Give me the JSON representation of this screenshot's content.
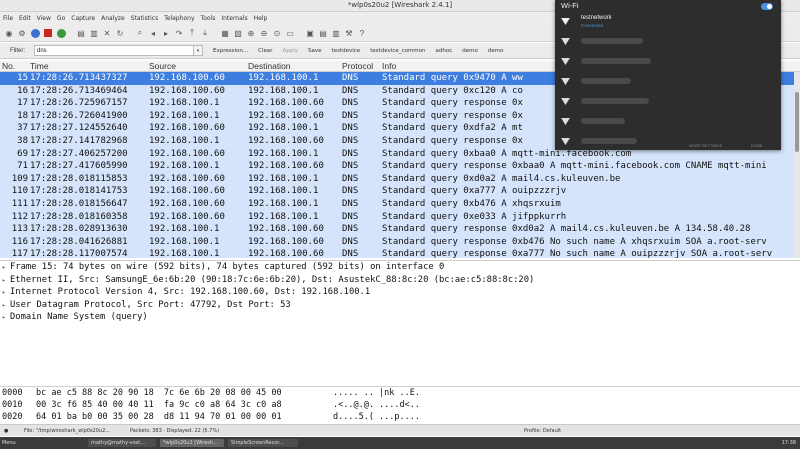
{
  "window": {
    "title": "*wlp0s20u2 [Wireshark 2.4.1]"
  },
  "menu": [
    "File",
    "Edit",
    "View",
    "Go",
    "Capture",
    "Analyze",
    "Statistics",
    "Telephony",
    "Tools",
    "Internals",
    "Help"
  ],
  "filter": {
    "label": "Filter:",
    "value": "dns",
    "buttons": [
      "Expression...",
      "Clear",
      "Apply",
      "Save",
      "testdevice",
      "testdevice_common",
      "adhoc",
      "demo",
      "demo"
    ]
  },
  "packet_list": {
    "columns": [
      "No.",
      "Time",
      "Source",
      "Destination",
      "Protocol",
      "Info"
    ],
    "selected_index": 0,
    "rows": [
      {
        "no": "15",
        "time": "17:28:26.713437327",
        "src": "192.168.100.60",
        "dst": "192.168.100.1",
        "proto": "DNS",
        "info": "Standard query 0x9470 A ww"
      },
      {
        "no": "16",
        "time": "17:28:26.713469464",
        "src": "192.168.100.60",
        "dst": "192.168.100.1",
        "proto": "DNS",
        "info": "Standard query 0xc120 A co"
      },
      {
        "no": "17",
        "time": "17:28:26.725967157",
        "src": "192.168.100.1",
        "dst": "192.168.100.60",
        "proto": "DNS",
        "info": "Standard query response 0x"
      },
      {
        "no": "18",
        "time": "17:28:26.726041900",
        "src": "192.168.100.1",
        "dst": "192.168.100.60",
        "proto": "DNS",
        "info": "Standard query response 0x"
      },
      {
        "no": "37",
        "time": "17:28:27.124552640",
        "src": "192.168.100.60",
        "dst": "192.168.100.1",
        "proto": "DNS",
        "info": "Standard query 0xdfa2 A mt"
      },
      {
        "no": "38",
        "time": "17:28:27.141782968",
        "src": "192.168.100.1",
        "dst": "192.168.100.60",
        "proto": "DNS",
        "info": "Standard query response 0x"
      },
      {
        "no": "69",
        "time": "17:28:27.406257200",
        "src": "192.168.100.60",
        "dst": "192.168.100.1",
        "proto": "DNS",
        "info": "Standard query 0xbaa0 A mqtt-mini.facebook.com"
      },
      {
        "no": "71",
        "time": "17:28:27.417605990",
        "src": "192.168.100.1",
        "dst": "192.168.100.60",
        "proto": "DNS",
        "info": "Standard query response 0xbaa0 A mqtt-mini.facebook.com CNAME mqtt-mini"
      },
      {
        "no": "109",
        "time": "17:28:28.018115853",
        "src": "192.168.100.60",
        "dst": "192.168.100.1",
        "proto": "DNS",
        "info": "Standard query 0xd0a2 A mail4.cs.kuleuven.be"
      },
      {
        "no": "110",
        "time": "17:28:28.018141753",
        "src": "192.168.100.60",
        "dst": "192.168.100.1",
        "proto": "DNS",
        "info": "Standard query 0xa777 A ouipzzzrjv"
      },
      {
        "no": "111",
        "time": "17:28:28.018156647",
        "src": "192.168.100.60",
        "dst": "192.168.100.1",
        "proto": "DNS",
        "info": "Standard query 0xb476 A xhqsrxuim"
      },
      {
        "no": "112",
        "time": "17:28:28.018160358",
        "src": "192.168.100.60",
        "dst": "192.168.100.1",
        "proto": "DNS",
        "info": "Standard query 0xe033 A jifppkurrh"
      },
      {
        "no": "113",
        "time": "17:28:28.028913630",
        "src": "192.168.100.1",
        "dst": "192.168.100.60",
        "proto": "DNS",
        "info": "Standard query response 0xd0a2 A mail4.cs.kuleuven.be A 134.58.40.28"
      },
      {
        "no": "116",
        "time": "17:28:28.041626881",
        "src": "192.168.100.1",
        "dst": "192.168.100.60",
        "proto": "DNS",
        "info": "Standard query response 0xb476 No such name A xhqsrxuim SOA a.root-serv"
      },
      {
        "no": "117",
        "time": "17:28:28.117007574",
        "src": "192.168.100.1",
        "dst": "192.168.100.60",
        "proto": "DNS",
        "info": "Standard query response 0xa777 No such name A ouipzzzrjv SOA a.root-serv"
      }
    ]
  },
  "details": [
    "Frame 15: 74 bytes on wire (592 bits), 74 bytes captured (592 bits) on interface 0",
    "Ethernet II, Src: SamsungE_6e:6b:20 (90:18:7c:6e:6b:20), Dst: AsustekC_88:8c:20 (bc:ae:c5:88:8c:20)",
    "Internet Protocol Version 4, Src: 192.168.100.60, Dst: 192.168.100.1",
    "User Datagram Protocol, Src Port: 47792, Dst Port: 53",
    "Domain Name System (query)"
  ],
  "hex": [
    {
      "offset": "0000",
      "bytes": "bc ae c5 88 8c 20 90 18  7c 6e 6b 20 08 00 45 00",
      "ascii": "..... .. |nk ..E."
    },
    {
      "offset": "0010",
      "bytes": "00 3c f6 85 40 00 40 11  fa 9c c0 a8 64 3c c0 a8",
      "ascii": ".<..@.@. ....d<.."
    },
    {
      "offset": "0020",
      "bytes": "64 01 ba b0 00 35 00 28  d8 11 94 70 01 00 00 01",
      "ascii": "d....5.( ...p...."
    }
  ],
  "status": {
    "file": "File: \"/tmp/wireshark_wlp0s20u2...",
    "packets": "Packets: 383 · Displayed: 22 (5.7%)",
    "profile": "Profile: Default"
  },
  "taskbar": {
    "menu": "Menu",
    "items": [
      "mathy@mathy-vost...",
      "*wlp0s20u2 [Wiresh...",
      "SimpleScreenRecor..."
    ],
    "clock": "17:38"
  },
  "wifi": {
    "title": "Wi-Fi",
    "enabled": true,
    "connected_network": "testnetwork",
    "connected_status": "Connected",
    "other_networks_count": 6,
    "footer_left": "MORE SETTINGS",
    "footer_right": "DONE"
  },
  "colors": {
    "row_bg": "#d5e4fb",
    "selected_row_bg": "#3d7ee0",
    "accent": "#4a90e2"
  }
}
